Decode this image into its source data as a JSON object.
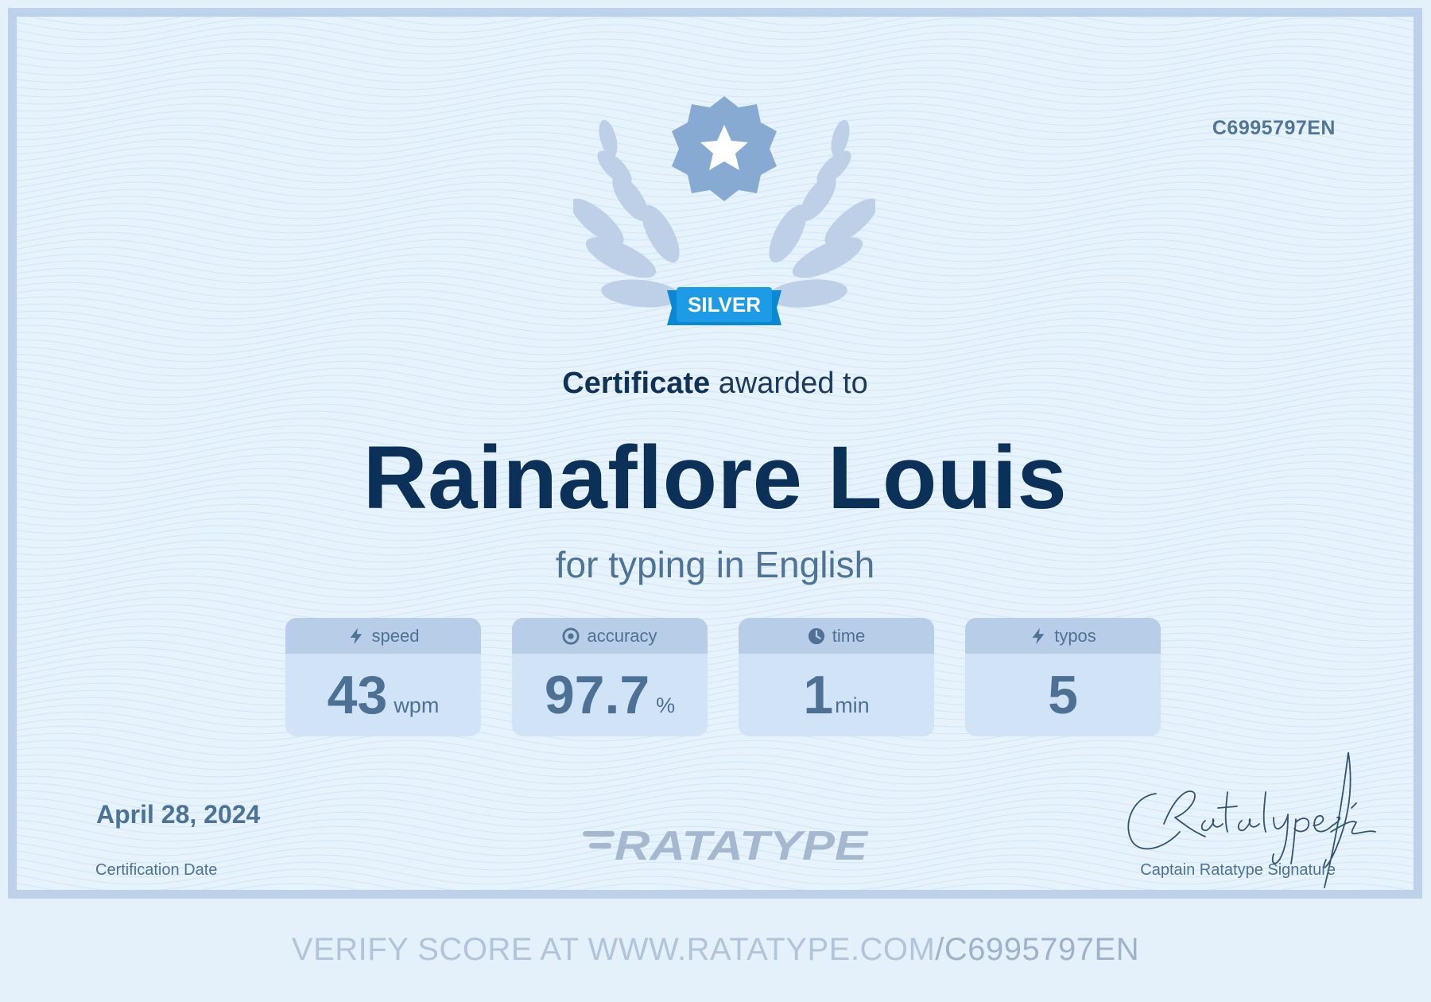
{
  "certificate": {
    "id": "C6995797EN",
    "badge": "SILVER",
    "heading_bold": "Certificate",
    "heading_rest": "awarded to",
    "recipient": "Rainaflore Louis",
    "subline": "for typing in English"
  },
  "stats": [
    {
      "label": "speed",
      "value": "43",
      "unit": "wpm",
      "icon": "lightning-icon"
    },
    {
      "label": "accuracy",
      "value": "97.7",
      "unit": "%",
      "icon": "target-icon"
    },
    {
      "label": "time",
      "value": "1",
      "unit": "min",
      "icon": "clock-icon"
    },
    {
      "label": "typos",
      "value": "5",
      "unit": "",
      "icon": "lightning-icon"
    }
  ],
  "footer": {
    "date": "April 28, 2024",
    "date_label": "Certification Date",
    "logo_text": "RATATYPE",
    "signature_label": "Captain Ratatype Signature"
  },
  "verify": {
    "prefix": "VERIFY SCORE AT WWW.RATATYPE.COM",
    "code": "/C6995797EN"
  },
  "colors": {
    "background": "#e7f3fc",
    "frame": "#bdd1ea",
    "title": "#0c3159",
    "accent": "#4e7397",
    "badge_ribbon": "#1e9be6",
    "emblem": "#86aad2"
  }
}
